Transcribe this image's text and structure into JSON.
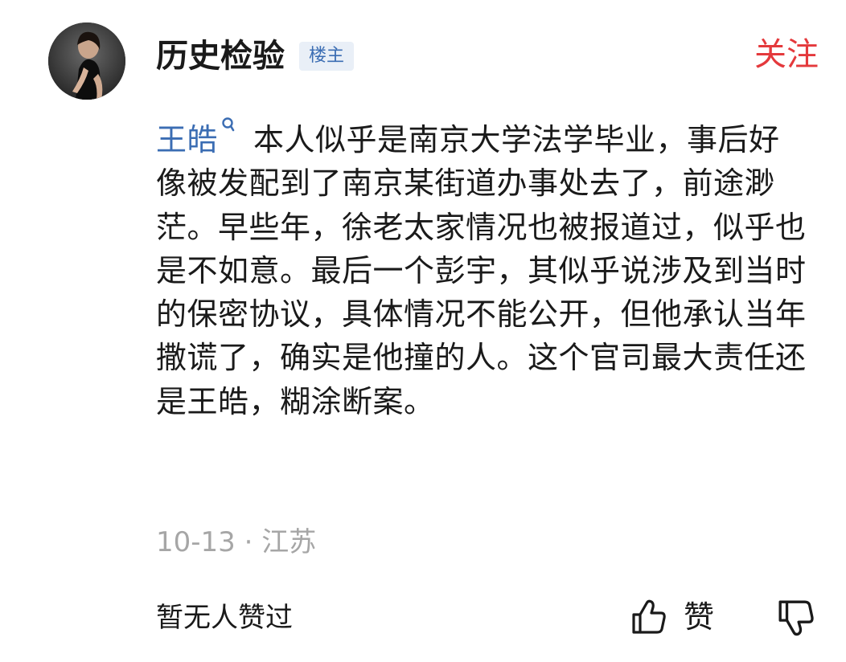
{
  "post": {
    "author": {
      "name": "历史检验",
      "badge": "楼主",
      "avatar_icon": "avatar-photo"
    },
    "follow_label": "关注",
    "follow_color": "#e4393c",
    "mention_name": "王皓",
    "mention_color": "#3b6db3",
    "comment_text": "本人似乎是南京大学法学毕业，事后好像被发配到了南京某街道办事处去了，前途渺茫。早些年，徐老太家情况也被报道过，似乎也是不如意。最后一个彭宇，其似乎说涉及到当时的保密协议，具体情况不能公开，但他承认当年撒谎了，确实是他撞的人。这个官司最大责任还是王皓，糊涂断案。",
    "meta": "10-13 · 江苏"
  },
  "actions": {
    "no_likes_text": "暂无人赞过",
    "like_label": "赞",
    "like_icon": "thumbs-up-icon",
    "dislike_icon": "thumbs-down-icon"
  }
}
